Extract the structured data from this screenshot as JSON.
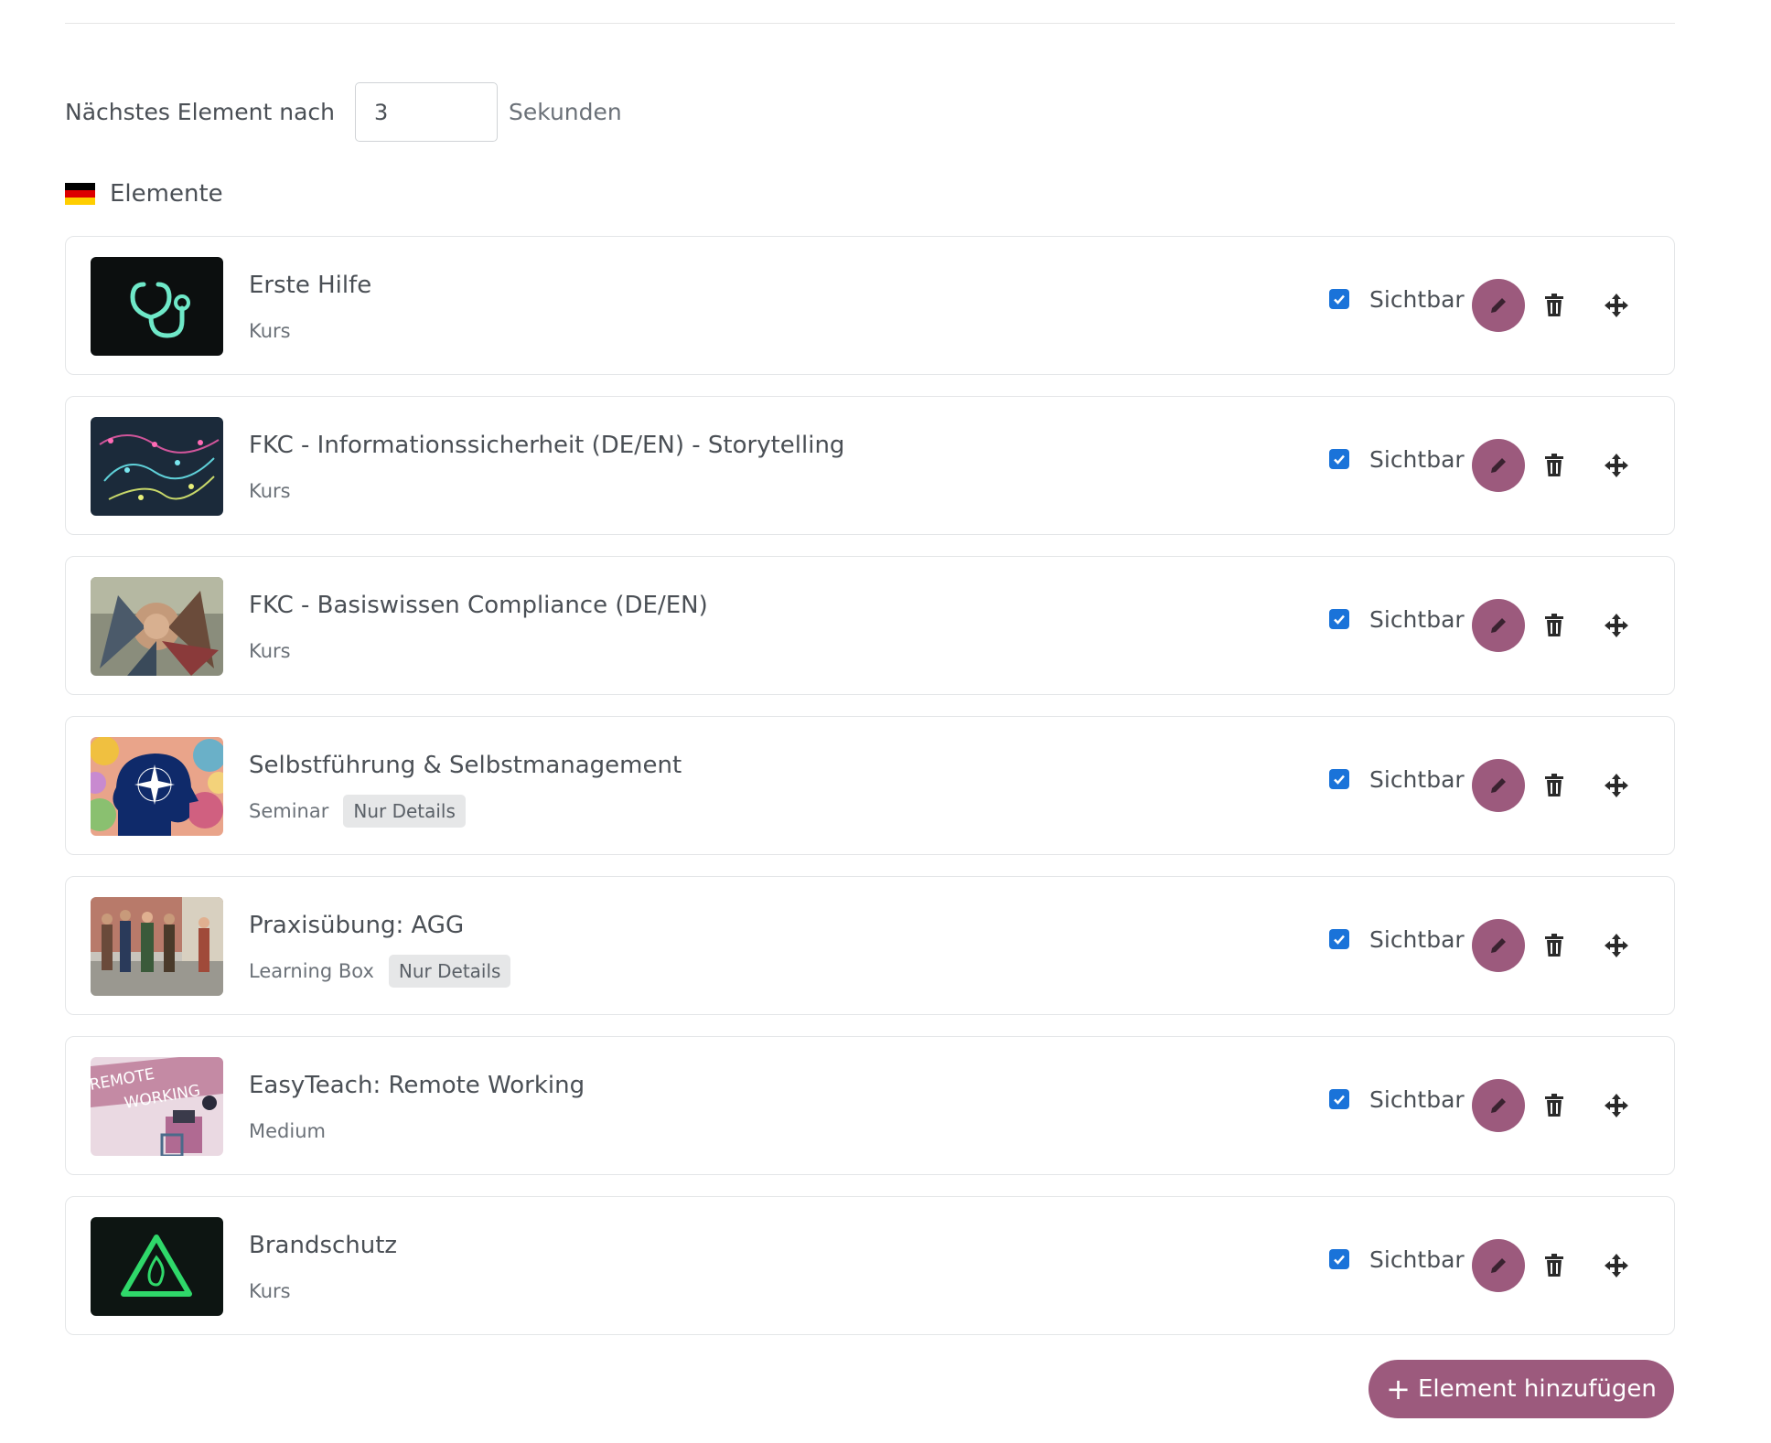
{
  "settings": {
    "delay_label": "Nächstes Element nach",
    "delay_value": "3",
    "delay_unit": "Sekunden"
  },
  "section": {
    "title": "Elemente",
    "flag": "german-flag-icon",
    "flag_colors": [
      "#000000",
      "#dd0000",
      "#ffce00"
    ]
  },
  "items": [
    {
      "title": "Erste Hilfe",
      "type": "Kurs",
      "badge": "",
      "visible_label": "Sichtbar",
      "visible": true,
      "thumb": "stethoscope-image"
    },
    {
      "title": "FKC - Informationssicherheit (DE/EN) - Storytelling",
      "type": "Kurs",
      "badge": "",
      "visible_label": "Sichtbar",
      "visible": true,
      "thumb": "network-map-image"
    },
    {
      "title": "FKC - Basiswissen Compliance (DE/EN)",
      "type": "Kurs",
      "badge": "",
      "visible_label": "Sichtbar",
      "visible": true,
      "thumb": "team-hands-image"
    },
    {
      "title": "Selbstführung & Selbstmanagement",
      "type": "Seminar",
      "badge": "Nur Details",
      "visible_label": "Sichtbar",
      "visible": true,
      "thumb": "head-compass-image"
    },
    {
      "title": "Praxisübung: AGG",
      "type": "Learning Box",
      "badge": "Nur Details",
      "visible_label": "Sichtbar",
      "visible": true,
      "thumb": "people-street-image"
    },
    {
      "title": "EasyTeach: Remote Working",
      "type": "Medium",
      "badge": "",
      "visible_label": "Sichtbar",
      "visible": true,
      "thumb": "remote-working-image",
      "thumb_text_1": "REMOTE",
      "thumb_text_2": "WORKING"
    },
    {
      "title": "Brandschutz",
      "type": "Kurs",
      "badge": "",
      "visible_label": "Sichtbar",
      "visible": true,
      "thumb": "fire-warning-image"
    }
  ],
  "actions": {
    "add_label": "Element hinzufügen",
    "add_icon": "plus-icon"
  },
  "colors": {
    "accent": "#9c5a7d",
    "checkbox": "#1a73d9",
    "border": "#e4e6e8",
    "text": "#4a4f55",
    "muted": "#6b7178"
  }
}
